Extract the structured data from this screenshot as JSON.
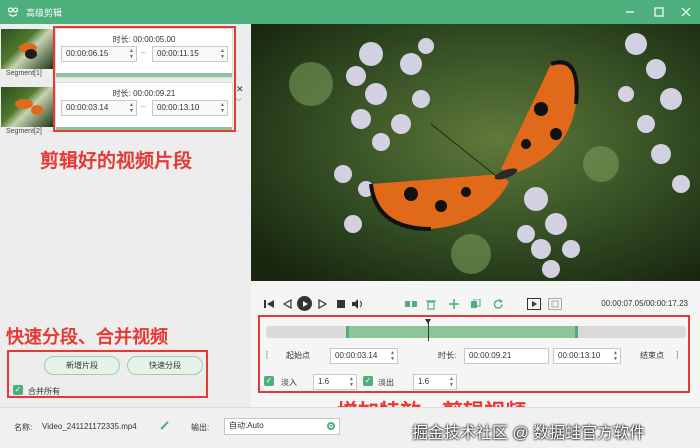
{
  "window": {
    "title": "高级剪辑",
    "app_icon": "frog-icon",
    "controls": [
      "minimize-icon",
      "maximize-icon",
      "close-icon"
    ]
  },
  "segments": [
    {
      "label": "Segment[1]",
      "duration": "时长:  00:00:05.00",
      "start": "00:00:06.15",
      "end": "00:00:11.15",
      "progress": 1.0
    },
    {
      "label": "Segment[2]",
      "duration": "时长:  00:00:09.21",
      "start": "00:00:03.14",
      "end": "00:00:13.10",
      "progress": 1.0
    }
  ],
  "segment_separator": "–",
  "annotations": {
    "segments": "剪辑好的视频片段",
    "quick": "快速分段、合并视频",
    "effects": "增加特效、剪辑视频"
  },
  "left_actions": {
    "new_segment": "新增片段",
    "quick_split": "快速分段",
    "merge_all": "合并所有"
  },
  "player": {
    "timecode": "00:00:07.05/00:00:17.23",
    "icons": [
      "skip-start-icon",
      "prev-frame-icon",
      "play-icon",
      "next-frame-icon",
      "stop-icon",
      "volume-icon",
      "split-icon",
      "delete-icon",
      "add-icon",
      "copy-icon",
      "reset-icon",
      "crop-icon",
      "ratio-icon"
    ]
  },
  "trim": {
    "start_bracket": "[",
    "start_label": "起始点",
    "start_value": "00:00:03.14",
    "duration_label": "时长:",
    "duration_value": "00:00:09.21",
    "end_value": "00:00:13.10",
    "end_label": "结束点",
    "end_bracket": "]",
    "fade_in_label": "淡入",
    "fade_in_value": "1.6",
    "fade_out_label": "淡出",
    "fade_out_value": "1.6"
  },
  "footer": {
    "name_label": "名称:",
    "name_value": "Video_241121172335.mp4",
    "output_label": "输出:",
    "output_value": "自动:Auto"
  },
  "watermark": "掘金技术社区 @ 数据蛙官方软件",
  "colors": {
    "accent": "#4caf7c",
    "annotation": "#e53935"
  }
}
